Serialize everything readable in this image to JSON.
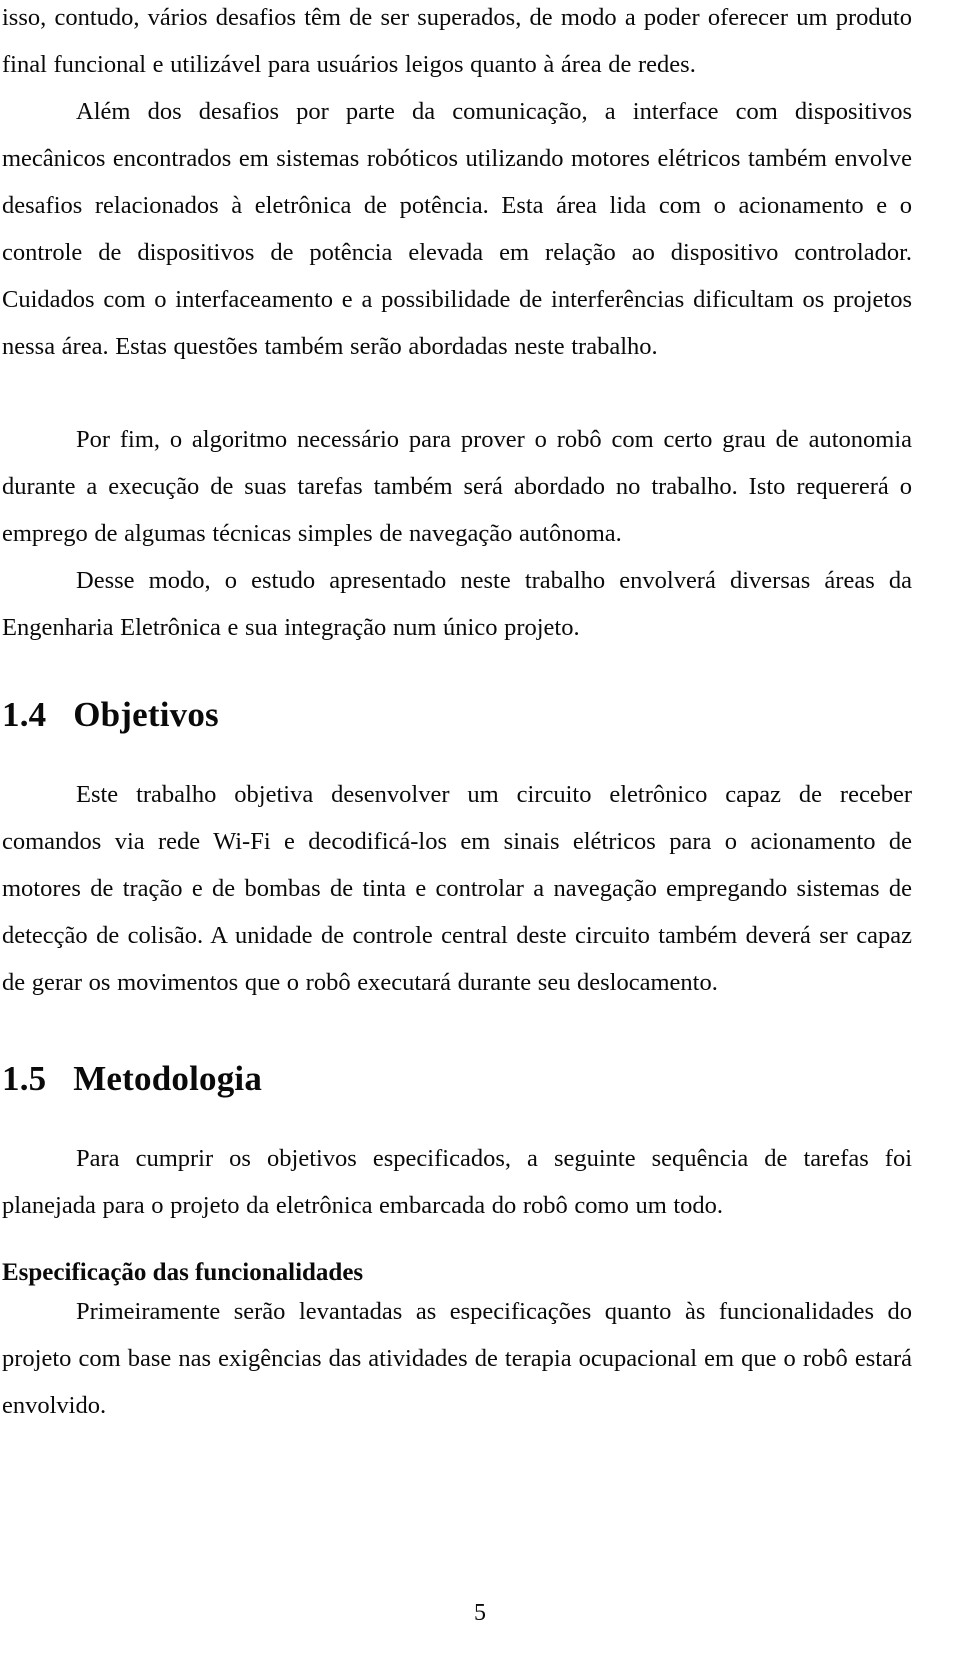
{
  "document": {
    "language": "pt-BR",
    "page_number": "5",
    "text_color": "#0a0a0a",
    "background_color": "#ffffff"
  },
  "paragraphs": {
    "continued_paragraph": "isso, contudo, vários desafios têm de ser superados, de modo a poder oferecer um produto final funcional e utilizável para usuários leigos quanto à área de redes.",
    "power_electronics": "Além dos desafios por parte da comunicação, a interface com dispositivos mecânicos encontrados em sistemas robóticos utilizando motores elétricos também envolve desafios relacionados à eletrônica de potência. Esta área lida com o acionamento e o controle de dispositivos de potência elevada em relação ao dispositivo controlador. Cuidados com o interfaceamento e a possibilidade de interferências dificultam os projetos nessa área. Estas questões também serão abordadas neste trabalho.",
    "algorithm": "Por fim, o algoritmo necessário para prover o robô com certo grau de autonomia durante a execução de suas tarefas também será abordado no trabalho. Isto requererá o emprego de algumas técnicas simples de navegação autônoma.",
    "conclusion": "Desse modo, o estudo apresentado neste trabalho envolverá diversas áreas da Engenharia Eletrônica e sua integração num único projeto."
  },
  "sections": {
    "objetivos": {
      "number": "1.4",
      "title": "Objetivos",
      "heading_display": "1.4   Objetivos",
      "paragraph": "Este trabalho objetiva desenvolver um circuito eletrônico capaz de receber comandos via rede Wi-Fi e decodificá-los em sinais elétricos para o acionamento de motores de tração e de bombas de tinta e controlar a navegação empregando sistemas de detecção de colisão. A unidade de controle central deste circuito também deverá ser capaz de gerar os movimentos que o robô executará durante seu deslocamento."
    },
    "metodologia": {
      "number": "1.5",
      "title": "Metodologia",
      "heading_display": "1.5   Metodologia",
      "paragraph": "Para cumprir os objetivos especificados, a seguinte sequência de tarefas foi planejada para o projeto da eletrônica embarcada do robô como um todo.",
      "subsections": [
        {
          "title": "Especificação das funcionalidades",
          "paragraph": "Primeiramente serão levantadas as especificações quanto às funcionalidades do projeto com base nas exigências das atividades de terapia ocupacional em que o robô estará envolvido."
        }
      ]
    }
  }
}
